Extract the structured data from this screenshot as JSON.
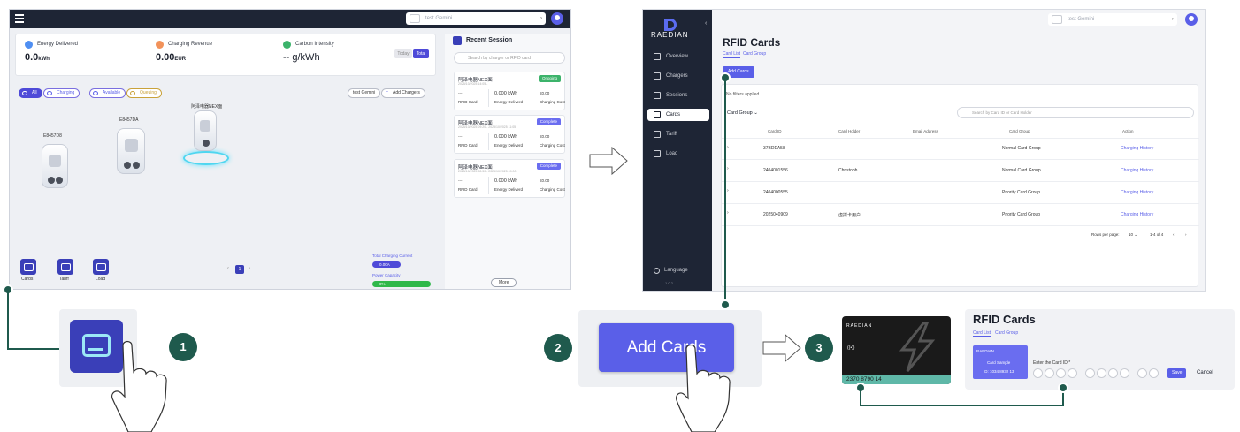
{
  "dashboard": {
    "user": "test Gemini",
    "stats": [
      {
        "label": "Energy Delivered",
        "value": "0.0",
        "unit": "kWh",
        "color": "#4f8ff2"
      },
      {
        "label": "Charging Revenue",
        "value": "0.00",
        "unit": "EUR",
        "color": "#f2925a"
      },
      {
        "label": "Carbon Intensity",
        "value": "-- g/kWh",
        "unit": "",
        "color": "#3cb36b"
      }
    ],
    "toggle": {
      "today": "Today",
      "total": "Total"
    },
    "filters": [
      "All",
      "Charging",
      "Available",
      "Queuing"
    ],
    "site_button": "test Gemini",
    "add_chargers": "Add Chargers",
    "chargers": [
      "E8457D8",
      "E8457DA",
      "阿泽电器NEX面"
    ],
    "bottom_nav": [
      "Cards",
      "Tariff",
      "Load"
    ],
    "page": "1",
    "recent_session": {
      "title": "Recent Session",
      "search_placeholder": "Search by charger or RFID card",
      "sessions": [
        {
          "name": "阿泽电器NEX面",
          "time": "2025/10/2025 14:05 -",
          "status": "Ongoing",
          "dash": "---",
          "rfid": "RFID Card",
          "energy": "0.000 kWh",
          "energy_label": "Energy Deliverd",
          "cost": "€0.00",
          "cost_label": "Charging Cost"
        },
        {
          "name": "阿泽电器NEX面",
          "time": "2025/10/2025 09:20 - 2025/10/2025 11:05",
          "status": "Complete",
          "dash": "---",
          "rfid": "RFID Card",
          "energy": "0.000 kWh",
          "energy_label": "Energy Deliverd",
          "cost": "€0.00",
          "cost_label": "Charging Cost"
        },
        {
          "name": "阿泽电器NEX面",
          "time": "2025/10/2025 08:30 - 2025/10/2025 09:00",
          "status": "Complete",
          "dash": "---",
          "rfid": "RFID Card",
          "energy": "0.000 kWh",
          "energy_label": "Energy Deliverd",
          "cost": "€0.00",
          "cost_label": "Charging Cost"
        }
      ],
      "current_label": "Total Charging Current",
      "current_value": "0.00A",
      "capacity_label": "Power Capacity",
      "capacity_value": "0%",
      "more": "More"
    }
  },
  "rfid_page": {
    "brand": "RAEDIAN",
    "user": "test Gemini",
    "nav": [
      "Overview",
      "Chargers",
      "Sessions",
      "Cards",
      "Tariff",
      "Load"
    ],
    "active_nav": "Cards",
    "language": "Language",
    "version": "1.0.2",
    "title": "RFID Cards",
    "tabs": [
      "Card List",
      "Card Group"
    ],
    "add_button": "Add Cards",
    "no_filters": "No filters applied",
    "group_select": "Card Group",
    "search_placeholder": "Search by Card ID or Card Holder",
    "columns": [
      "Card ID",
      "Card Holder",
      "Email Address",
      "Card Group",
      "Action"
    ],
    "rows": [
      {
        "id": "37BDEA58",
        "holder": "",
        "email": "",
        "group": "Normal Card Group",
        "action": "Charging History"
      },
      {
        "id": "2404001556",
        "holder": "Christoph",
        "email": "",
        "group": "Normal Card Group",
        "action": "Charging History"
      },
      {
        "id": "2404000555",
        "holder": "",
        "email": "",
        "group": "Priority Card Group",
        "action": "Charging History"
      },
      {
        "id": "2025040909",
        "holder": "虚拟卡用户",
        "email": "",
        "group": "Priority Card Group",
        "action": "Charging History"
      }
    ],
    "rows_per_page": "Rows per page:",
    "rows_per_page_value": "10",
    "range": "1-4 of 4"
  },
  "steps": {
    "one": "1",
    "two": "2",
    "three": "3",
    "zoom_add_cards": "Add Cards"
  },
  "rfid_card": {
    "brand": "RAEDIAN",
    "nfc": "((•))",
    "number": "2370 8790 14"
  },
  "add_form": {
    "title": "RFID Cards",
    "tabs": [
      "Card List",
      "Card Group"
    ],
    "sample_brand": "RAEDIAN",
    "sample_label": "Card Sample",
    "sample_id": "ID: 1034 8932 13",
    "enter_label": "Enter the Card ID *",
    "save": "Save",
    "cancel": "Cancel"
  },
  "colors": {
    "accent": "#5a5fe8",
    "dark_nav": "#1e2535",
    "step_green": "#1f5a4d",
    "ongoing": "#3cb36b",
    "complete": "#6a6df0"
  }
}
